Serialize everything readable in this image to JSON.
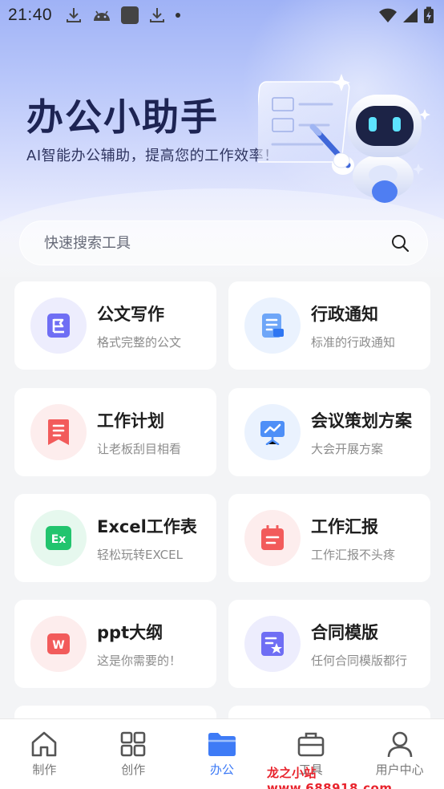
{
  "status_bar": {
    "time": "21:40"
  },
  "hero": {
    "title": "办公小助手",
    "subtitle": "AI智能办公辅助，提高您的工作效率！"
  },
  "search": {
    "placeholder": "快速搜索工具"
  },
  "cards": [
    {
      "title": "公文写作",
      "desc": "格式完整的公文",
      "icon": "flag-doc-icon",
      "color": "#6f6ef4",
      "bg": "#ededfd"
    },
    {
      "title": "行政通知",
      "desc": "标准的行政通知",
      "icon": "notice-doc-icon",
      "color": "#4e8ff7",
      "bg": "#eaf2fe"
    },
    {
      "title": "工作计划",
      "desc": "让老板刮目相看",
      "icon": "bookmark-list-icon",
      "color": "#f25b5b",
      "bg": "#fdeded"
    },
    {
      "title": "会议策划方案",
      "desc": "大会开展方案",
      "icon": "presentation-icon",
      "color": "#4e8ff7",
      "bg": "#eaf2fe"
    },
    {
      "title": "Excel工作表",
      "desc": "轻松玩转EXCEL",
      "icon": "excel-icon",
      "color": "#22c46e",
      "bg": "#e6f8ee"
    },
    {
      "title": "工作汇报",
      "desc": "工作汇报不头疼",
      "icon": "calendar-report-icon",
      "color": "#f25b5b",
      "bg": "#fdeded"
    },
    {
      "title": "ppt大纲",
      "desc": "这是你需要的！",
      "icon": "ppt-icon",
      "color": "#f25b5b",
      "bg": "#fdeded"
    },
    {
      "title": "合同模版",
      "desc": "任何合同模版都行",
      "icon": "contract-star-icon",
      "color": "#6f6ef4",
      "bg": "#ededfd"
    }
  ],
  "tabs": [
    {
      "label": "制作",
      "icon": "home-icon",
      "active": false
    },
    {
      "label": "创作",
      "icon": "grid-icon",
      "active": false
    },
    {
      "label": "办公",
      "icon": "folder-icon",
      "active": true
    },
    {
      "label": "工具",
      "icon": "briefcase-icon",
      "active": false
    },
    {
      "label": "用户中心",
      "icon": "user-icon",
      "active": false
    }
  ],
  "watermark": "龙之小站 www.688918.com",
  "colors": {
    "accent": "#3e7bf6",
    "title": "#1d2453"
  }
}
